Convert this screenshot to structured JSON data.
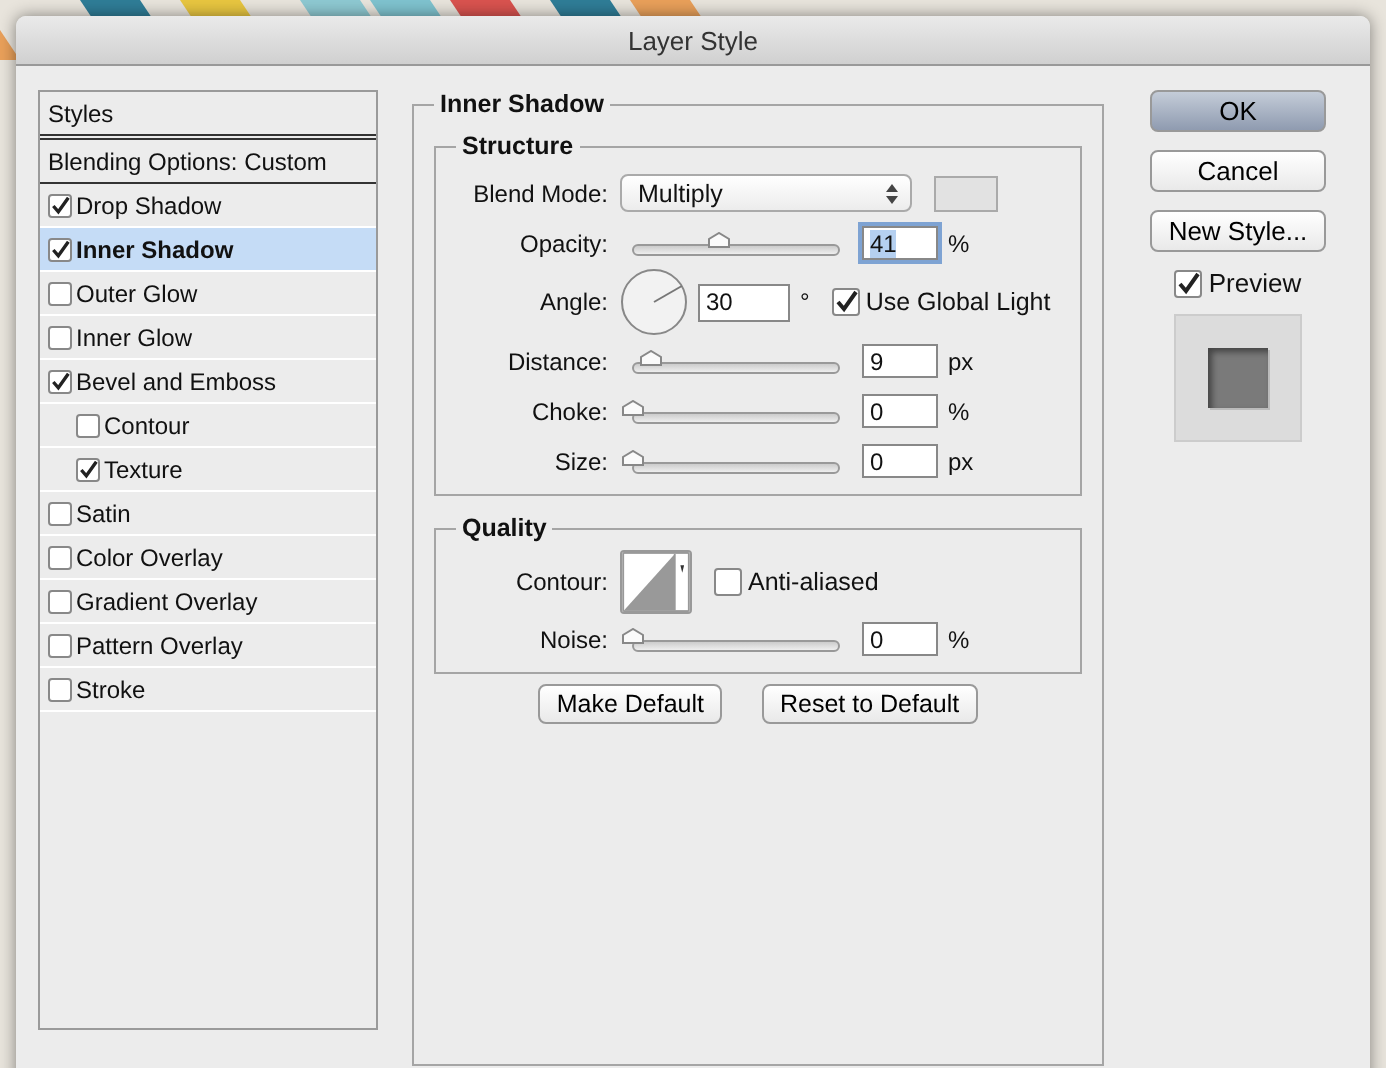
{
  "window": {
    "title": "Layer Style"
  },
  "styles_list": {
    "header": "Styles",
    "blending_options": "Blending Options: Custom",
    "items": [
      {
        "label": "Drop Shadow",
        "checked": true,
        "selected": false
      },
      {
        "label": "Inner Shadow",
        "checked": true,
        "selected": true
      },
      {
        "label": "Outer Glow",
        "checked": false,
        "selected": false
      },
      {
        "label": "Inner Glow",
        "checked": false,
        "selected": false
      },
      {
        "label": "Bevel and Emboss",
        "checked": true,
        "selected": false,
        "children": [
          {
            "label": "Contour",
            "checked": false,
            "selected": false
          },
          {
            "label": "Texture",
            "checked": true,
            "selected": false
          }
        ]
      },
      {
        "label": "Satin",
        "checked": false,
        "selected": false
      },
      {
        "label": "Color Overlay",
        "checked": false,
        "selected": false
      },
      {
        "label": "Gradient Overlay",
        "checked": false,
        "selected": false
      },
      {
        "label": "Pattern Overlay",
        "checked": false,
        "selected": false
      },
      {
        "label": "Stroke",
        "checked": false,
        "selected": false
      }
    ]
  },
  "panel": {
    "title": "Inner Shadow",
    "structure": {
      "title": "Structure",
      "rows": [
        {
          "kind": "select",
          "label": "Blend Mode:",
          "value": "Multiply"
        },
        {
          "kind": "slider",
          "label": "Opacity:",
          "level": 0.41,
          "value": "41",
          "unit": "%",
          "focused": true
        },
        {
          "kind": "angle",
          "label": "Angle:",
          "value": "30",
          "unit": "°",
          "global_light": {
            "label": "Use Global Light",
            "checked": true
          }
        },
        {
          "kind": "slider",
          "label": "Distance:",
          "level": 0.09,
          "value": "9",
          "unit": "px",
          "focused": false
        },
        {
          "kind": "slider",
          "label": "Choke:",
          "level": 0,
          "value": "0",
          "unit": "%",
          "focused": false
        },
        {
          "kind": "slider",
          "label": "Size:",
          "level": 0,
          "value": "0",
          "unit": "px",
          "focused": false
        }
      ]
    },
    "quality": {
      "title": "Quality",
      "rows": [
        {
          "kind": "contour",
          "label": "Contour:",
          "anti_aliased": {
            "label": "Anti-aliased",
            "checked": false
          }
        },
        {
          "kind": "slider",
          "label": "Noise:",
          "level": 0,
          "value": "0",
          "unit": "%",
          "focused": false
        }
      ]
    },
    "buttons": [
      "Make Default",
      "Reset to Default"
    ]
  },
  "actions": {
    "buttons": [
      {
        "label": "OK",
        "default": true
      },
      {
        "label": "Cancel",
        "default": false
      },
      {
        "label": "New Style...",
        "default": false
      }
    ],
    "preview": {
      "label": "Preview",
      "checked": true
    }
  }
}
